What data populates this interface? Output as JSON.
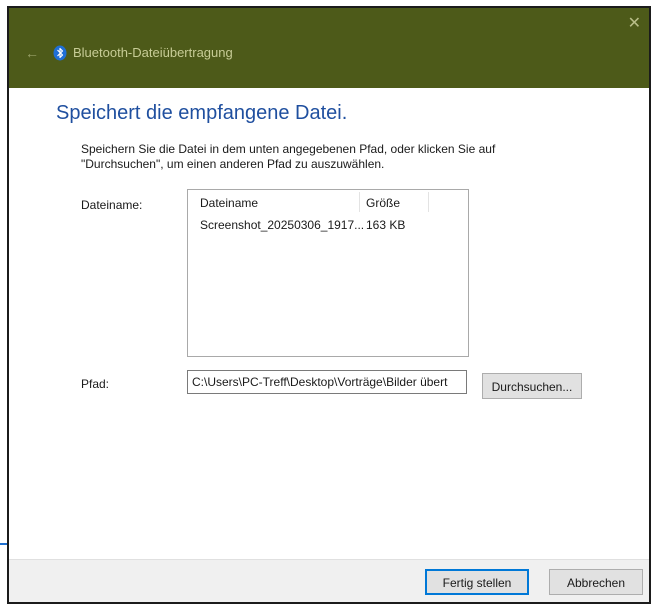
{
  "window": {
    "title": "Bluetooth-Dateiübertragung",
    "back_icon": "back-arrow-icon",
    "app_icon": "bluetooth-icon",
    "close_icon": "close-icon",
    "titlebar_color": "#4d5a19",
    "back_glyph": "←",
    "close_glyph": "✕"
  },
  "main": {
    "heading": "Speichert die empfangene Datei.",
    "instructions": "Speichern Sie die Datei in dem unten angegebenen Pfad, oder klicken Sie auf \"Durchsuchen\", um einen anderen Pfad zu auszuwählen.",
    "filename_label": "Dateiname:",
    "path_label": "Pfad:",
    "file_list": {
      "columns": [
        "Dateiname",
        "Größe"
      ],
      "rows": [
        {
          "name": "Screenshot_20250306_1917...",
          "size": "163 KB"
        }
      ]
    },
    "path_value": "C:\\Users\\PC-Treff\\Desktop\\Vorträge\\Bilder übert",
    "browse_label": "Durchsuchen..."
  },
  "footer": {
    "finish_label": "Fertig stellen",
    "cancel_label": "Abbrechen"
  },
  "colors": {
    "heading": "#1f4f9f",
    "default_button_border": "#0078d7"
  }
}
